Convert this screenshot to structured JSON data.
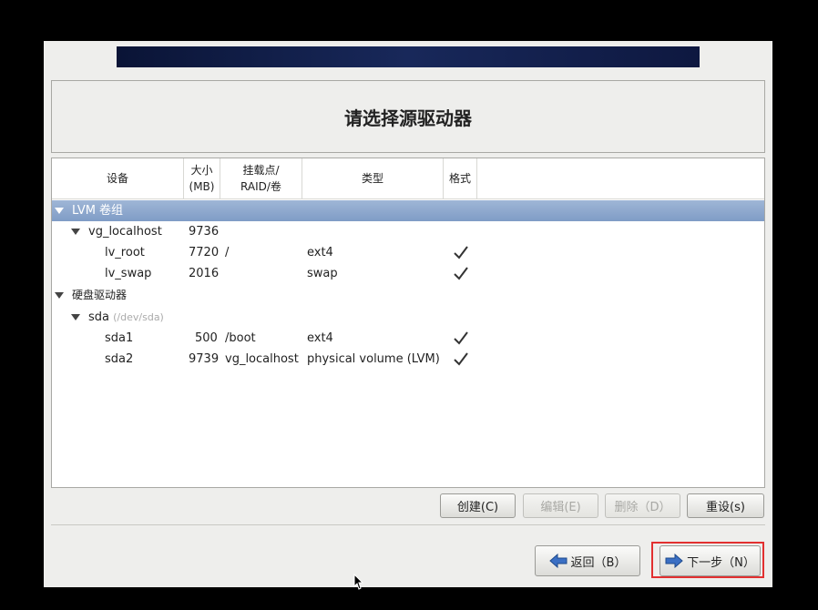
{
  "header": {
    "title": "请选择源驱动器"
  },
  "columns": {
    "device": "设备",
    "size": "大小\n(MB)",
    "mount": "挂载点/\nRAID/卷",
    "type": "类型",
    "format": "格式"
  },
  "rows": [
    {
      "label": "LVM 卷组",
      "size": "",
      "mount": "",
      "type": "",
      "format": false,
      "selected": true
    },
    {
      "label": "vg_localhost",
      "size": "9736",
      "mount": "",
      "type": "",
      "format": false
    },
    {
      "label": "lv_root",
      "size": "7720",
      "mount": "/",
      "type": "ext4",
      "format": true
    },
    {
      "label": "lv_swap",
      "size": "2016",
      "mount": "",
      "type": "swap",
      "format": true
    },
    {
      "label": "硬盘驱动器",
      "size": "",
      "mount": "",
      "type": "",
      "format": false
    },
    {
      "label": "sda",
      "path": "(/dev/sda)",
      "size": "",
      "mount": "",
      "type": "",
      "format": false
    },
    {
      "label": "sda1",
      "size": "500",
      "mount": "/boot",
      "type": "ext4",
      "format": true
    },
    {
      "label": "sda2",
      "size": "9739",
      "mount": "vg_localhost",
      "type": "physical volume (LVM)",
      "format": true
    }
  ],
  "buttons": {
    "create": "创建(C)",
    "edit": "编辑(E)",
    "delete": "删除（D）",
    "reset": "重设(s)",
    "back": "返回（B）",
    "next": "下一步（N）"
  },
  "colors": {
    "selection": "#8aa6cc",
    "highlight": "#e23030",
    "banner": "#0e1a44"
  }
}
